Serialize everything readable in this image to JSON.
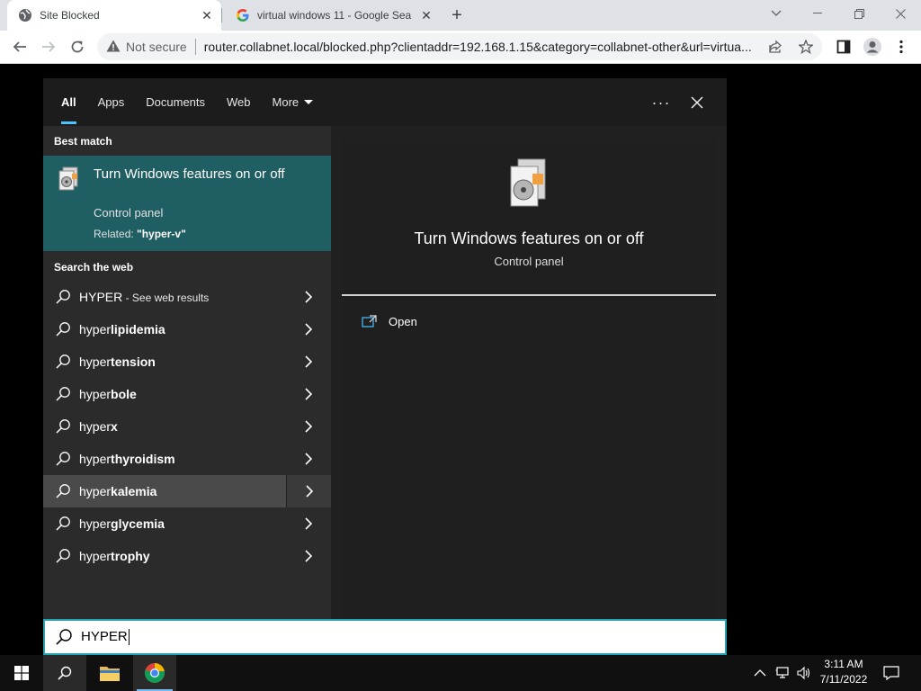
{
  "browser": {
    "tabs": [
      {
        "title": "Site Blocked",
        "active": true
      },
      {
        "title": "virtual windows 11 - Google Sea",
        "active": false
      }
    ],
    "omnibox": {
      "security_label": "Not secure",
      "url": "router.collabnet.local/blocked.php?clientaddr=192.168.1.15&category=collabnet-other&url=virtua..."
    }
  },
  "search": {
    "nav_tabs": [
      "All",
      "Apps",
      "Documents",
      "Web",
      "More"
    ],
    "best_match_heading": "Best match",
    "best_match": {
      "title": "Turn Windows features on or off",
      "subtitle": "Control panel",
      "related_prefix": "Related: ",
      "related_value": "\"hyper-v\""
    },
    "web_heading": "Search the web",
    "web_results": [
      {
        "plain": "HYPER",
        "bold": "",
        "suffix": " - See web results"
      },
      {
        "plain": "hyper",
        "bold": "lipidemia",
        "suffix": ""
      },
      {
        "plain": "hyper",
        "bold": "tension",
        "suffix": ""
      },
      {
        "plain": "hyper",
        "bold": "bole",
        "suffix": ""
      },
      {
        "plain": "hyper",
        "bold": "x",
        "suffix": ""
      },
      {
        "plain": "hyper",
        "bold": "thyroidism",
        "suffix": ""
      },
      {
        "plain": "hyper",
        "bold": "kalemia",
        "suffix": ""
      },
      {
        "plain": "hyper",
        "bold": "glycemia",
        "suffix": ""
      },
      {
        "plain": "hyper",
        "bold": "trophy",
        "suffix": ""
      }
    ],
    "preview": {
      "title": "Turn Windows features on or off",
      "subtitle": "Control panel",
      "open_label": "Open"
    },
    "query": "HYPER"
  },
  "taskbar": {
    "time": "3:11 AM",
    "date": "7/11/2022"
  },
  "colors": {
    "accent": "#4cc2ff",
    "best_match_bg": "#1f5f63",
    "search_border": "#2aa3b0"
  }
}
